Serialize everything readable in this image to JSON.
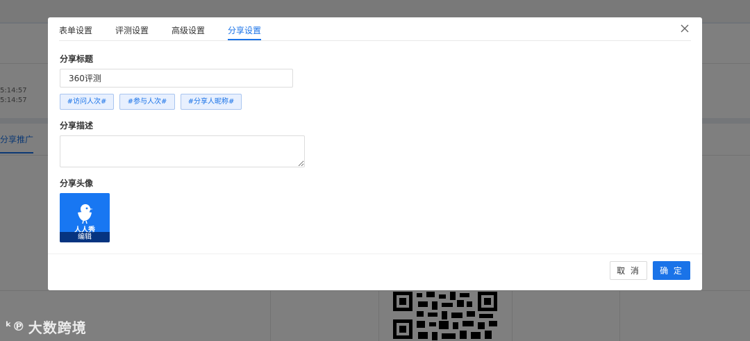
{
  "background": {
    "times": [
      "5:14:57",
      "5:14:57"
    ],
    "tab_label": "分享推广",
    "watermark": "大数跨境"
  },
  "modal": {
    "tabs": [
      {
        "label": "表单设置",
        "active": false
      },
      {
        "label": "评测设置",
        "active": false
      },
      {
        "label": "高级设置",
        "active": false
      },
      {
        "label": "分享设置",
        "active": true
      }
    ],
    "share_title_label": "分享标题",
    "share_title_value": "360评测",
    "tags": [
      "#访问人次#",
      "#参与人次#",
      "#分享人昵称#"
    ],
    "share_desc_label": "分享描述",
    "share_desc_value": "",
    "share_avatar_label": "分享头像",
    "avatar_brand": "人人秀",
    "avatar_edit_label": "编辑",
    "cancel_label": "取 消",
    "ok_label": "确 定"
  },
  "colors": {
    "accent": "#1a73e8",
    "avatar_bg": "#1877f2",
    "tag_bg": "#e8f0fe"
  },
  "icons": [
    "close-icon",
    "bird-logo-icon",
    "qr-code-icon",
    "watermark-logo-icon"
  ]
}
